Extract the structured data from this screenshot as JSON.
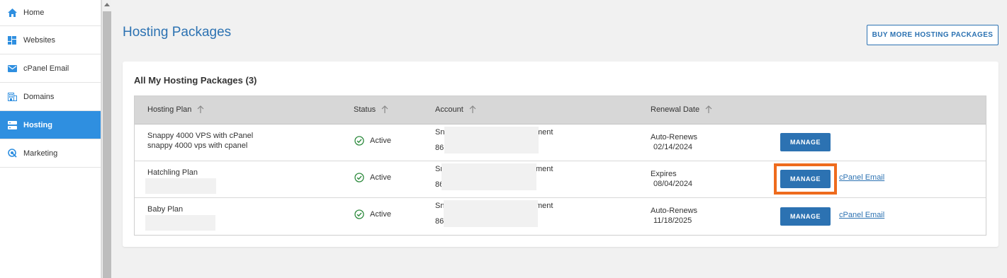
{
  "sidebar": {
    "items": [
      {
        "label": "Home",
        "icon": "home-icon"
      },
      {
        "label": "Websites",
        "icon": "websites-icon"
      },
      {
        "label": "cPanel Email",
        "icon": "envelope-icon"
      },
      {
        "label": "Domains",
        "icon": "domains-icon"
      },
      {
        "label": "Hosting",
        "icon": "server-icon",
        "active": true
      },
      {
        "label": "Marketing",
        "icon": "marketing-icon"
      }
    ]
  },
  "page": {
    "title": "Hosting Packages",
    "buy_button": "BUY MORE HOSTING PACKAGES"
  },
  "card": {
    "title": "All My Hosting Packages (3)"
  },
  "table": {
    "columns": [
      "Hosting Plan",
      "Status",
      "Account",
      "Renewal Date"
    ],
    "rows": [
      {
        "plan_name": "Snappy 4000 VPS with cPanel",
        "plan_sub": "snappy 4000 vps with cpanel",
        "status": "Active",
        "account_line1_start": "Sn",
        "account_line1_end": "ment",
        "account_line2_start": "86",
        "renewal_type": "Auto-Renews",
        "renewal_date": "02/14/2024",
        "manage_label": "MANAGE",
        "email_link": ""
      },
      {
        "plan_name": "Hatchling Plan",
        "plan_sub": "",
        "status": "Active",
        "account_line1_start": "Sn",
        "account_line1_end": "ment",
        "account_line2_start": "86",
        "renewal_type": "Expires",
        "renewal_date": "08/04/2024",
        "manage_label": "MANAGE",
        "email_link": "cPanel Email"
      },
      {
        "plan_name": "Baby Plan",
        "plan_sub": "",
        "status": "Active",
        "account_line1_start": "Sn",
        "account_line1_end": "ment",
        "account_line2_start": "86",
        "renewal_type": "Auto-Renews",
        "renewal_date": "11/18/2025",
        "manage_label": "MANAGE",
        "email_link": "cPanel Email"
      }
    ]
  },
  "colors": {
    "accent": "#2c72b2",
    "active_nav": "#2f8fe0",
    "highlight": "#ee6b1d",
    "status_green": "#2e8b3e"
  }
}
